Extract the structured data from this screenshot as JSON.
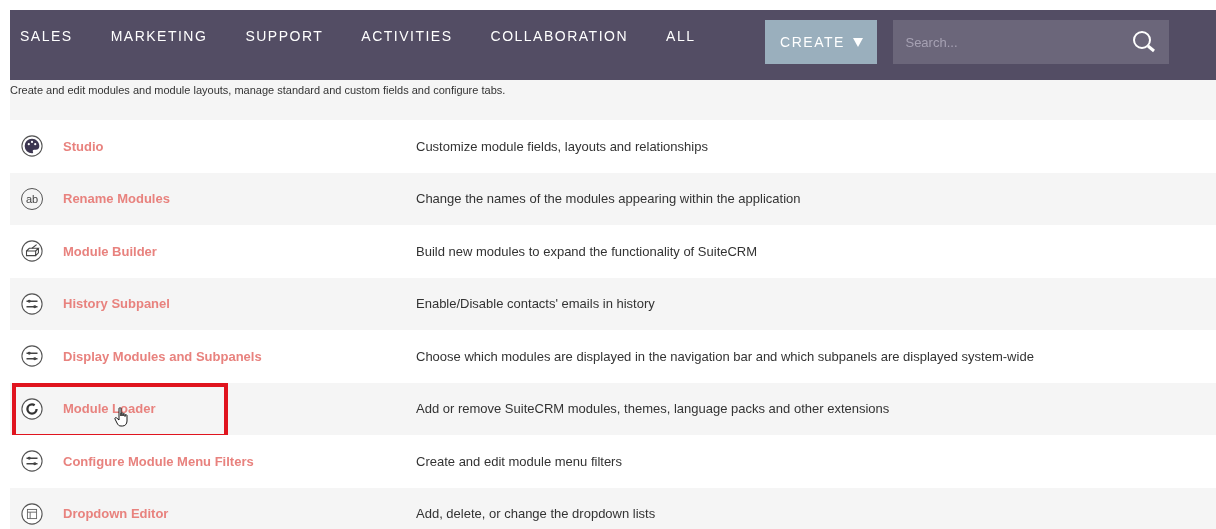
{
  "nav": {
    "tabs": [
      {
        "label": "SALES"
      },
      {
        "label": "MARKETING"
      },
      {
        "label": "SUPPORT"
      },
      {
        "label": "ACTIVITIES"
      },
      {
        "label": "COLLABORATION"
      },
      {
        "label": "ALL"
      }
    ],
    "create_button": "CREATE",
    "search": {
      "placeholder": "Search..."
    }
  },
  "intro": "Create and edit modules and module layouts, manage standard and custom fields and configure tabs.",
  "items": [
    {
      "kind": "palette",
      "title": "Studio",
      "description": "Customize module fields, layouts and relationships",
      "highlighted": false,
      "hovered": false
    },
    {
      "kind": "text",
      "icon_text": "ab",
      "title": "Rename Modules",
      "description": "Change the names of the modules appearing within the application",
      "highlighted": false,
      "hovered": false
    },
    {
      "kind": "builder",
      "title": "Module Builder",
      "description": "Build new modules to expand the functionality of SuiteCRM",
      "highlighted": false,
      "hovered": false
    },
    {
      "kind": "sliders",
      "title": "History Subpanel",
      "description": "Enable/Disable contacts' emails in history",
      "highlighted": false,
      "hovered": false
    },
    {
      "kind": "sliders",
      "title": "Display Modules and Subpanels",
      "description": "Choose which modules are displayed in the navigation bar and which subpanels are displayed system-wide",
      "highlighted": false,
      "hovered": false
    },
    {
      "kind": "loader",
      "title": "Module Loader",
      "description": "Add or remove SuiteCRM modules, themes, language packs and other extensions",
      "highlighted": true,
      "hovered": true
    },
    {
      "kind": "sliders",
      "title": "Configure Module Menu Filters",
      "description": "Create and edit module menu filters",
      "highlighted": false,
      "hovered": false
    },
    {
      "kind": "layout",
      "title": "Dropdown Editor",
      "description": "Add, delete, or change the dropdown lists",
      "highlighted": false,
      "hovered": false
    }
  ]
}
